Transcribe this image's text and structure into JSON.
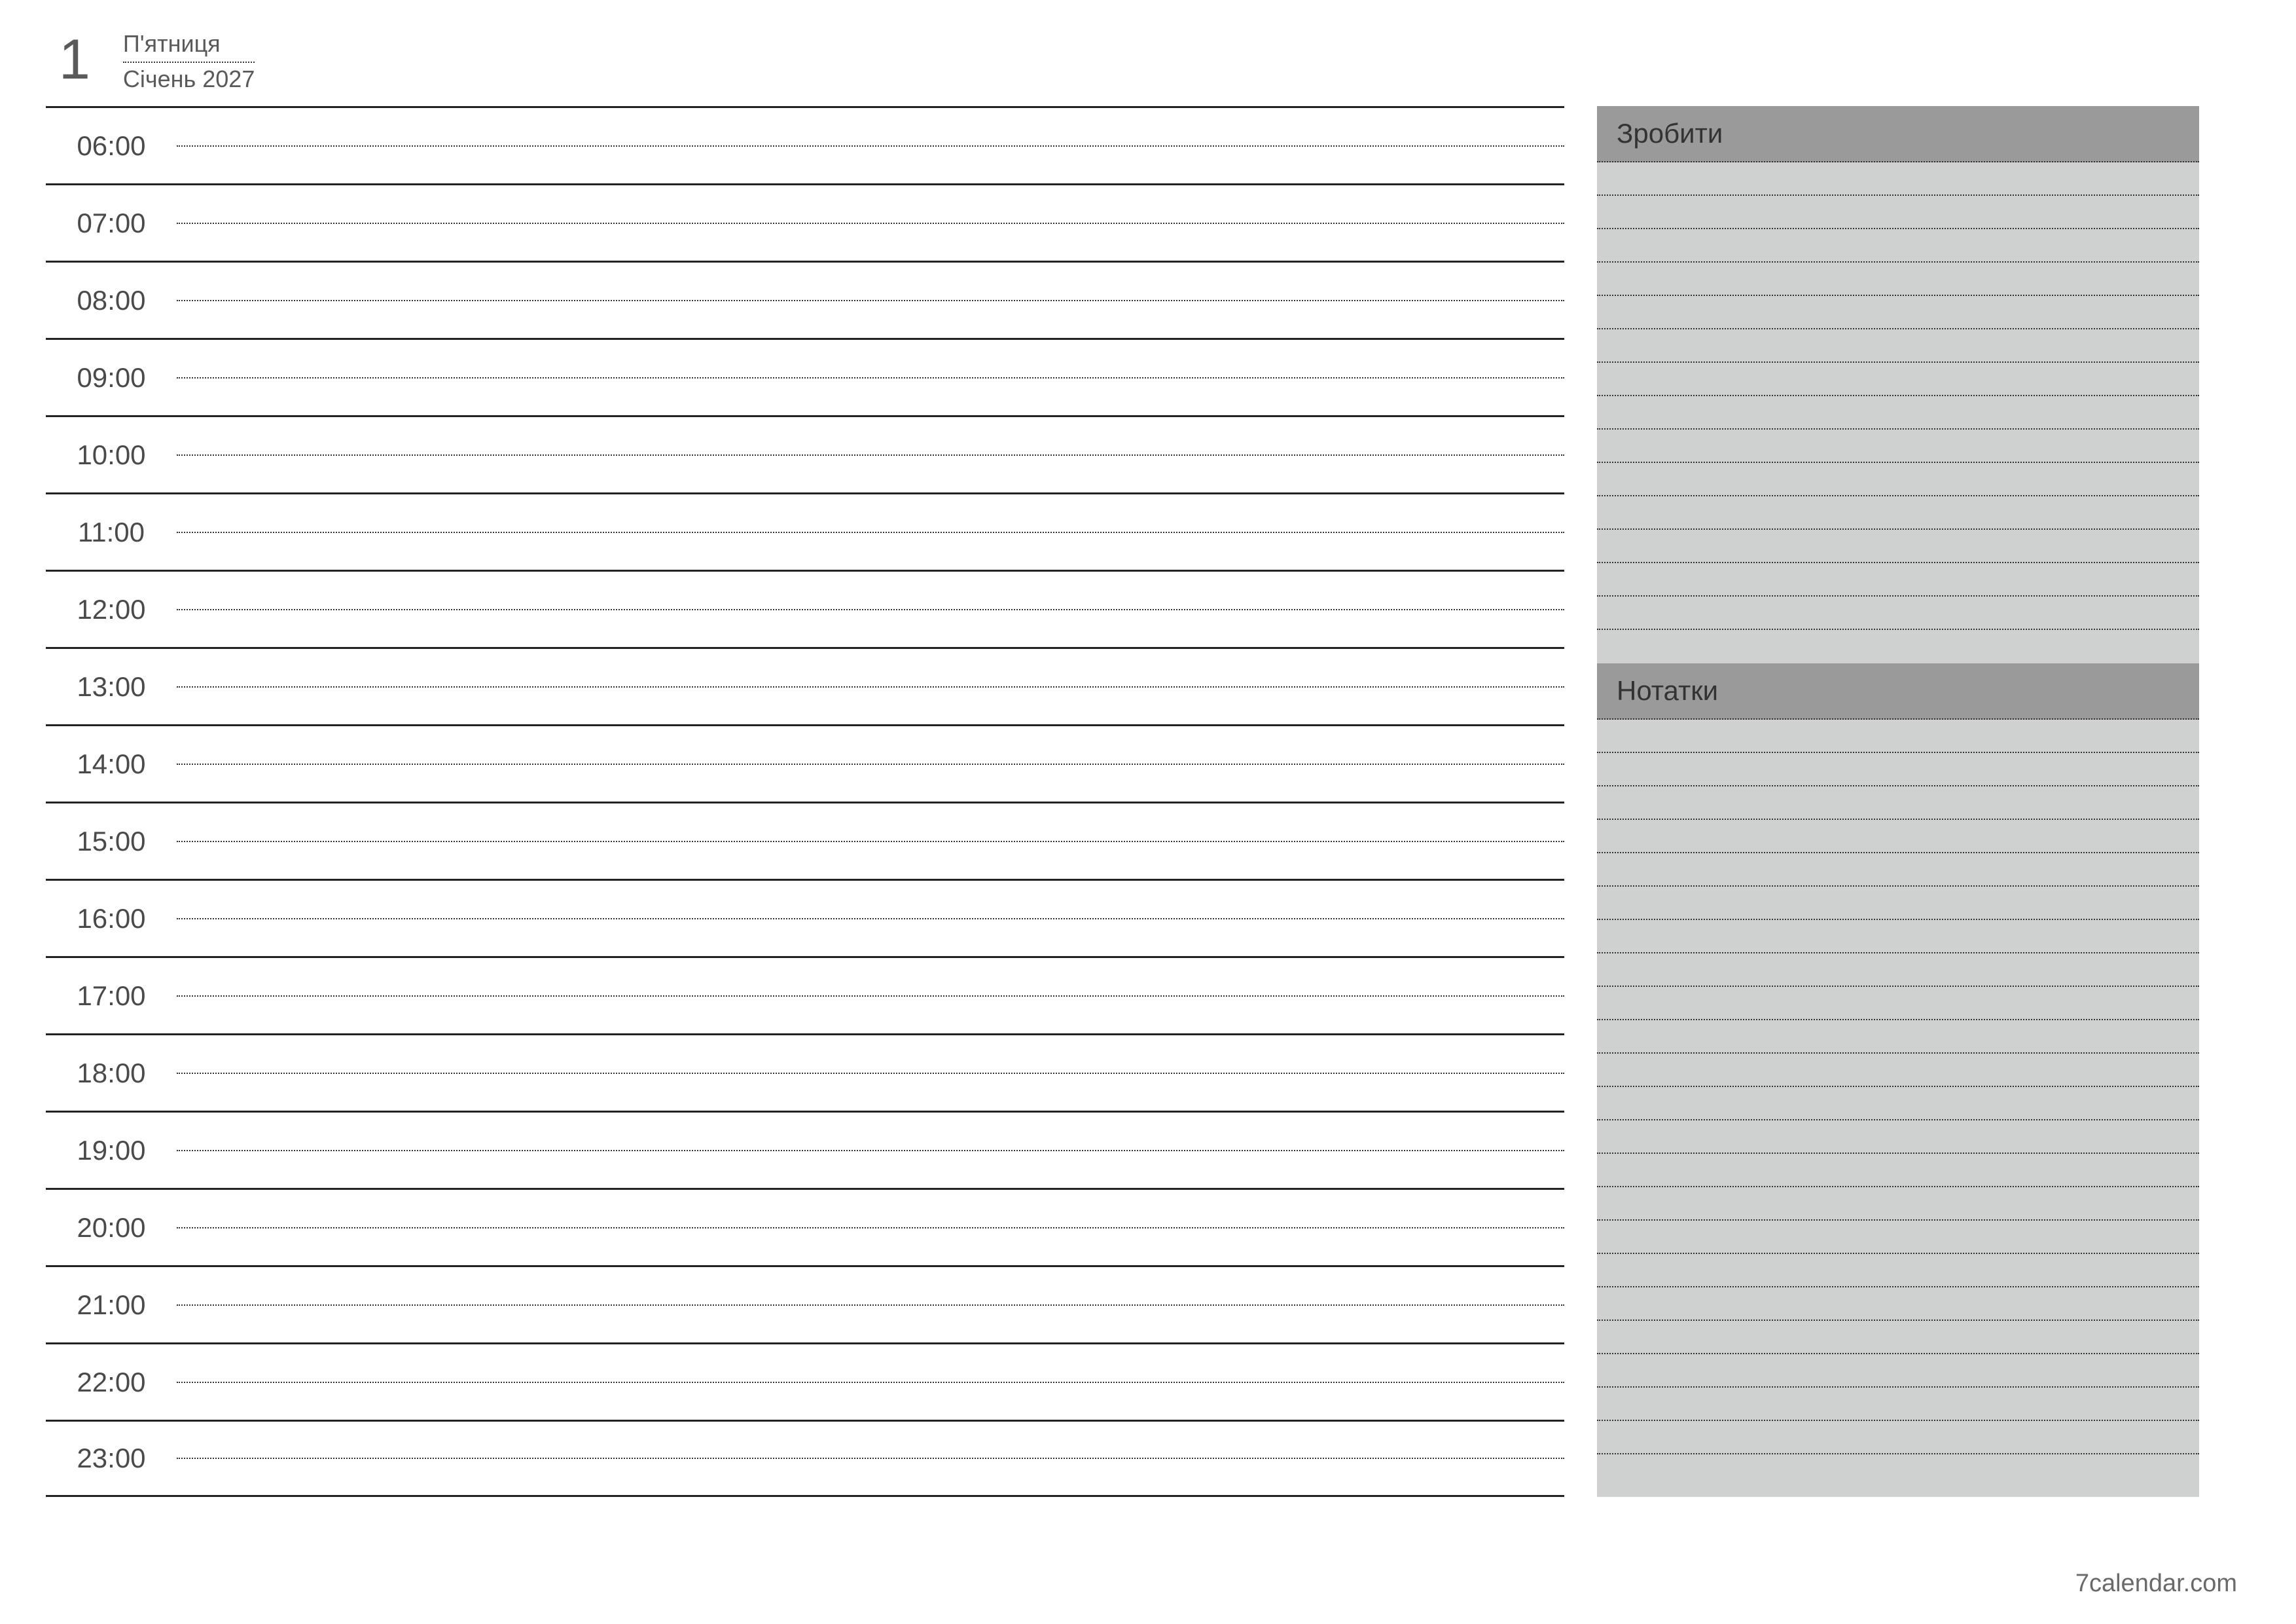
{
  "header": {
    "day_number": "1",
    "day_name": "П'ятниця",
    "month_year": "Січень 2027"
  },
  "schedule": {
    "hours": [
      "06:00",
      "07:00",
      "08:00",
      "09:00",
      "10:00",
      "11:00",
      "12:00",
      "13:00",
      "14:00",
      "15:00",
      "16:00",
      "17:00",
      "18:00",
      "19:00",
      "20:00",
      "21:00",
      "22:00",
      "23:00"
    ]
  },
  "sidebar": {
    "todo_title": "Зробити",
    "notes_title": "Нотатки",
    "todo_lines": 15,
    "notes_lines": 23
  },
  "footer": {
    "credit": "7calendar.com"
  }
}
